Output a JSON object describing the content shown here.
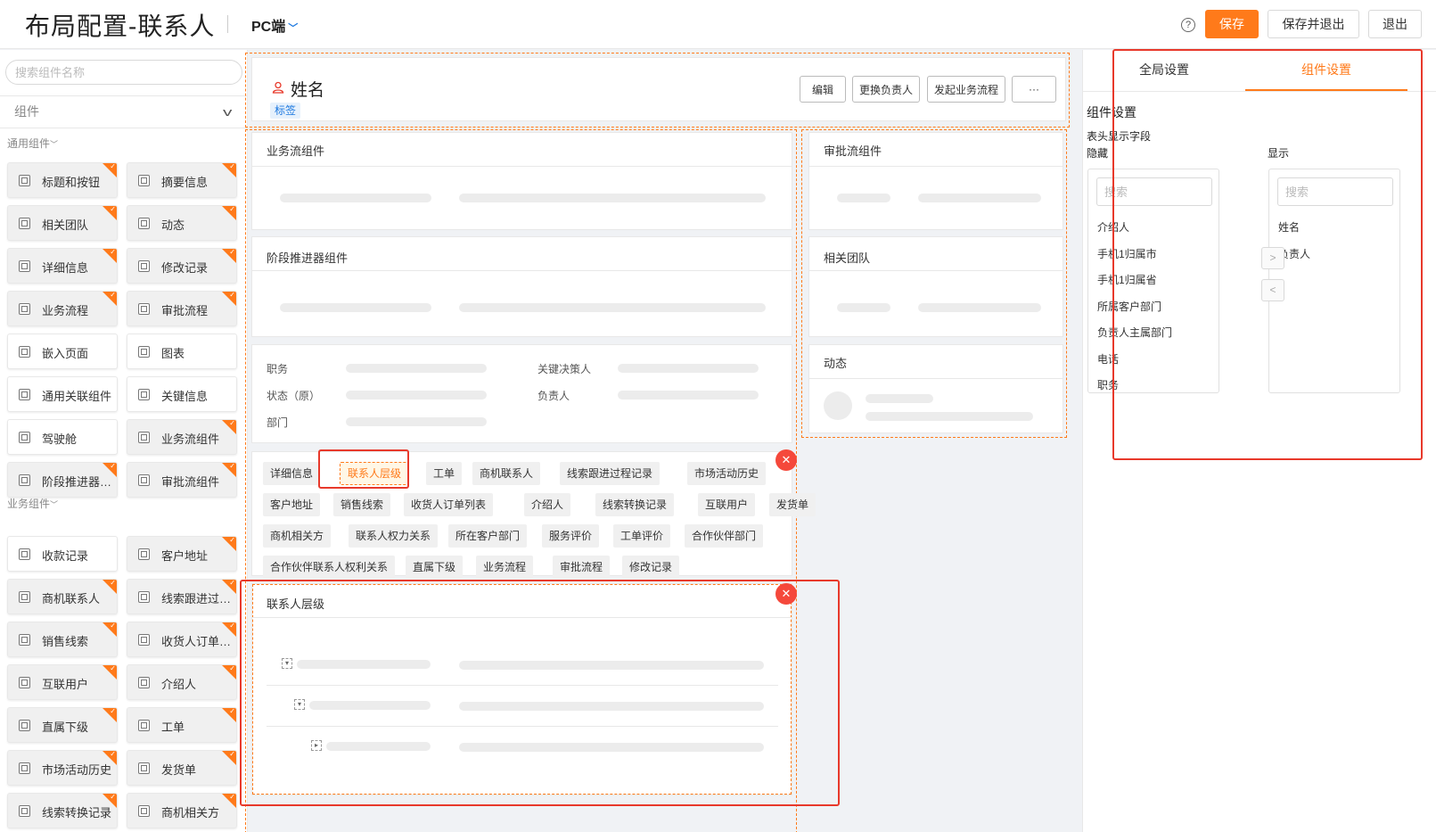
{
  "header": {
    "title": "布局配置-联系人",
    "platform": "PC端",
    "help": "?",
    "save": "保存",
    "save_exit": "保存并退出",
    "exit": "退出"
  },
  "sidebar": {
    "search_placeholder": "搜索组件名称",
    "select_label": "组件",
    "general_title": "通用组件",
    "business_title": "业务组件",
    "general": [
      {
        "label": "标题和按钮",
        "added": true
      },
      {
        "label": "摘要信息",
        "added": true
      },
      {
        "label": "相关团队",
        "added": true
      },
      {
        "label": "动态",
        "added": true
      },
      {
        "label": "详细信息",
        "added": true
      },
      {
        "label": "修改记录",
        "added": true
      },
      {
        "label": "业务流程",
        "added": true
      },
      {
        "label": "审批流程",
        "added": true
      },
      {
        "label": "嵌入页面",
        "added": false
      },
      {
        "label": "图表",
        "added": false
      },
      {
        "label": "通用关联组件",
        "added": false
      },
      {
        "label": "关键信息",
        "added": false
      },
      {
        "label": "驾驶舱",
        "added": false
      },
      {
        "label": "业务流组件",
        "added": true
      },
      {
        "label": "阶段推进器组件",
        "added": true
      },
      {
        "label": "审批流组件",
        "added": true
      }
    ],
    "business": [
      {
        "label": "收款记录",
        "added": false
      },
      {
        "label": "客户地址",
        "added": true
      },
      {
        "label": "商机联系人",
        "added": true
      },
      {
        "label": "线索跟进过程记录",
        "added": true
      },
      {
        "label": "销售线索",
        "added": true
      },
      {
        "label": "收货人订单列表",
        "added": true
      },
      {
        "label": "互联用户",
        "added": true
      },
      {
        "label": "介绍人",
        "added": true
      },
      {
        "label": "直属下级",
        "added": true
      },
      {
        "label": "工单",
        "added": true
      },
      {
        "label": "市场活动历史",
        "added": true
      },
      {
        "label": "发货单",
        "added": true
      },
      {
        "label": "线索转换记录",
        "added": true
      },
      {
        "label": "商机相关方",
        "added": true
      }
    ]
  },
  "canvas": {
    "record_name": "姓名",
    "record_tag": "标签",
    "actions": [
      "编辑",
      "更换负责人",
      "发起业务流程",
      "···"
    ],
    "card_business_flow": "业务流组件",
    "card_stage": "阶段推进器组件",
    "card_approval_flow": "审批流组件",
    "card_team": "相关团队",
    "card_dynamic": "动态",
    "fields_left": [
      "职务",
      "状态（原）",
      "部门"
    ],
    "fields_right": [
      "关键决策人",
      "负责人"
    ],
    "tabs": [
      "详细信息",
      "联系人层级",
      "工单",
      "商机联系人",
      "线索跟进过程记录",
      "市场活动历史",
      "客户地址",
      "销售线索",
      "收货人订单列表",
      "介绍人",
      "线索转换记录",
      "互联用户",
      "发货单",
      "商机相关方",
      "联系人权力关系",
      "所在客户部门",
      "服务评价",
      "工单评价",
      "合作伙伴部门",
      "合作伙伴联系人权利关系",
      "直属下级",
      "业务流程",
      "审批流程",
      "修改记录"
    ],
    "active_tab": "联系人层级",
    "hierarchy_title": "联系人层级",
    "close_glyph": "✕"
  },
  "right_panel": {
    "tab_global": "全局设置",
    "tab_component": "组件设置",
    "section_title": "组件设置",
    "header_fields": "表头显示字段",
    "hidden_label": "隐藏",
    "shown_label": "显示",
    "search_placeholder": "搜索",
    "hidden_items": [
      "介绍人",
      "手机1归属市",
      "手机1归属省",
      "所属客户部门",
      "负责人主属部门",
      "电话",
      "职务"
    ],
    "shown_items": [
      "姓名",
      "负责人"
    ],
    "move_right": ">",
    "move_left": "<"
  },
  "colors": {
    "accent": "#ff7a1a",
    "highlight_red": "#e8392b",
    "tag_blue": "#1f7ae0"
  }
}
